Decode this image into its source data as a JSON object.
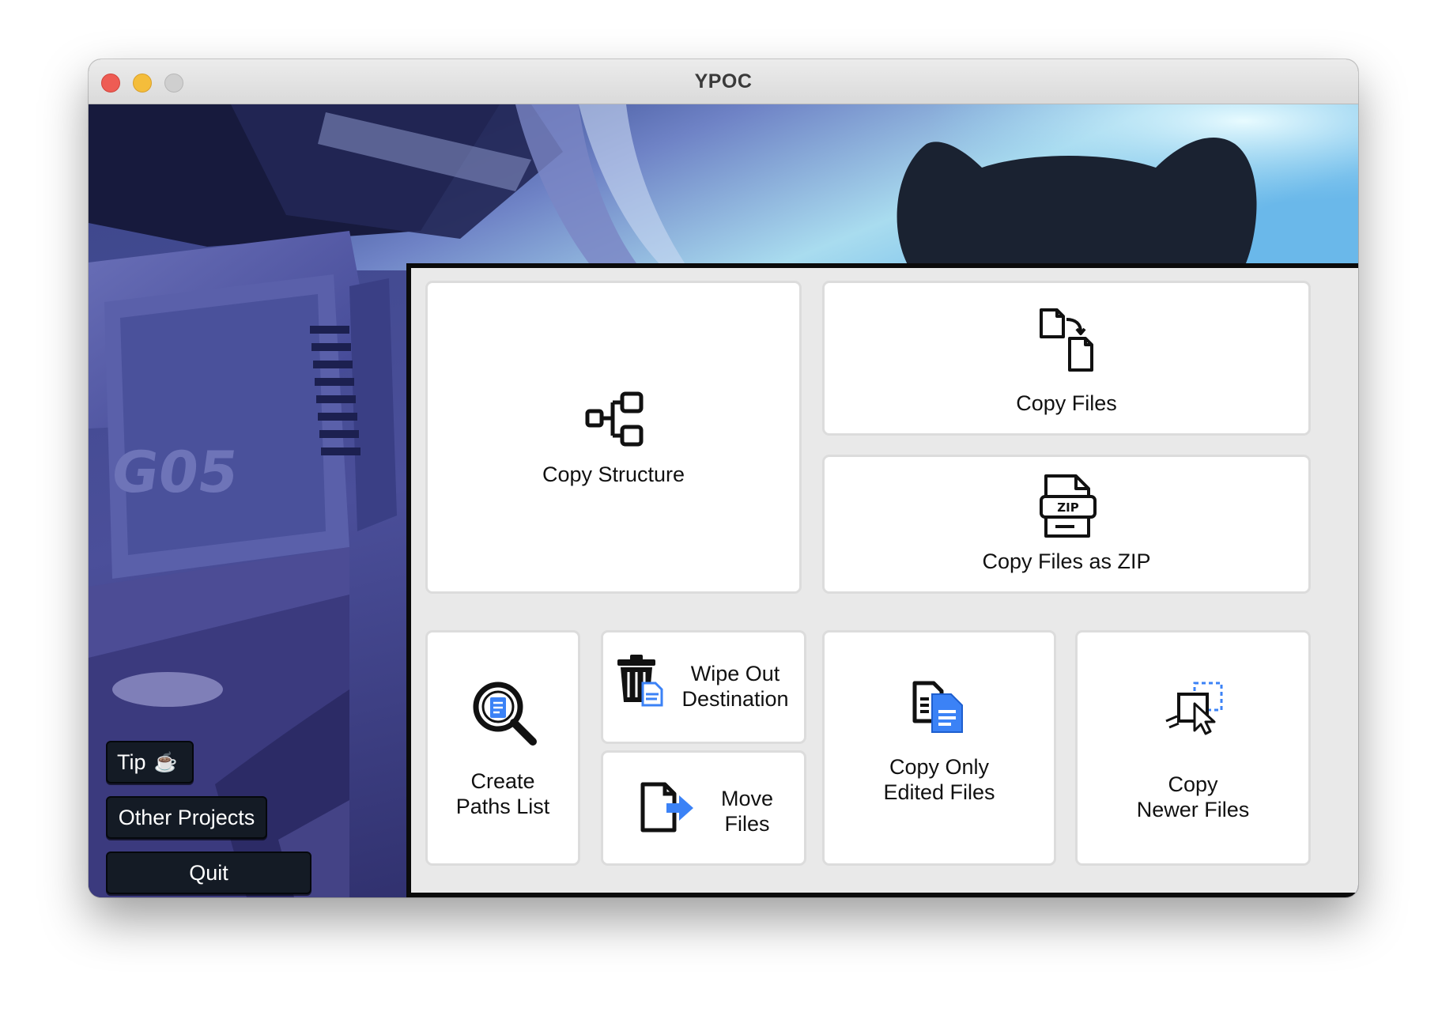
{
  "window": {
    "title": "YPOC"
  },
  "sidebar": {
    "tip_label": "Tip",
    "tip_icon": "coffee-cup-icon",
    "other_projects_label": "Other Projects",
    "quit_label": "Quit"
  },
  "actions": {
    "copy_structure": {
      "label": "Copy Structure",
      "icon": "structure-tree-icon"
    },
    "copy_files": {
      "label": "Copy Files",
      "icon": "copy-files-icon"
    },
    "copy_zip": {
      "label": "Copy Files as ZIP",
      "icon": "zip-file-icon",
      "icon_text": "ZIP"
    },
    "create_paths": {
      "line1": "Create",
      "line2": "Paths List",
      "icon": "magnifier-document-icon"
    },
    "wipe_out": {
      "line1": "Wipe Out",
      "line2": "Destination",
      "icon": "trash-document-icon"
    },
    "move_files": {
      "line1": "Move",
      "line2": "Files",
      "icon": "move-file-arrow-icon"
    },
    "copy_edited": {
      "line1": "Copy Only",
      "line2": "Edited Files",
      "icon": "edited-files-icon"
    },
    "copy_newer": {
      "line1": "Copy",
      "line2": "Newer Files",
      "icon": "newer-files-cursor-icon"
    }
  },
  "colors": {
    "panel_bg": "#e9e9e9",
    "card_bg": "#ffffff",
    "accent_blue": "#3b82f6",
    "sidebar_button_bg": "#141b25"
  }
}
